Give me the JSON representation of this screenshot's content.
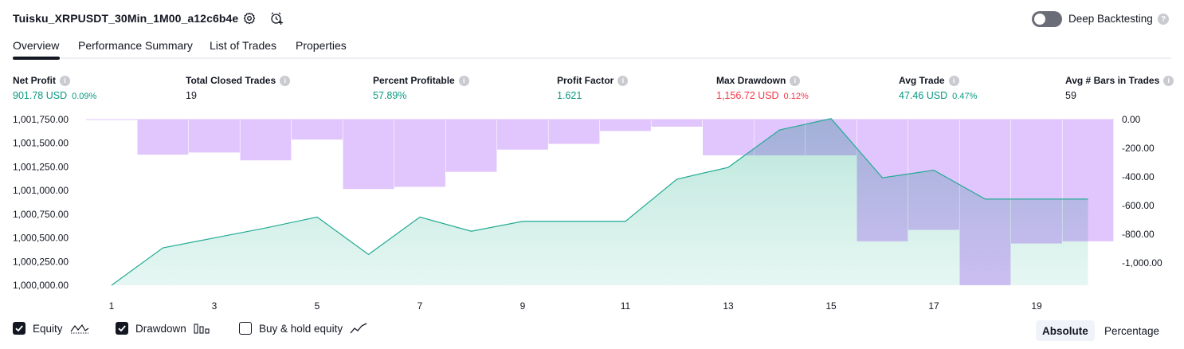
{
  "header": {
    "title": "Tuisku_XRPUSDT_30Min_1M00_a12c6b4e",
    "deep_backtesting_label": "Deep Backtesting",
    "deep_backtesting_on": false
  },
  "tabs": [
    {
      "label": "Overview",
      "active": true
    },
    {
      "label": "Performance Summary",
      "active": false
    },
    {
      "label": "List of Trades",
      "active": false
    },
    {
      "label": "Properties",
      "active": false
    }
  ],
  "stats": [
    {
      "label": "Net Profit",
      "value": "901.78 USD",
      "pct": "0.09%",
      "tone": "green"
    },
    {
      "label": "Total Closed Trades",
      "value": "19",
      "pct": "",
      "tone": "black"
    },
    {
      "label": "Percent Profitable",
      "value": "57.89%",
      "pct": "",
      "tone": "green"
    },
    {
      "label": "Profit Factor",
      "value": "1.621",
      "pct": "",
      "tone": "green"
    },
    {
      "label": "Max Drawdown",
      "value": "1,156.72 USD",
      "pct": "0.12%",
      "tone": "red"
    },
    {
      "label": "Avg Trade",
      "value": "47.46 USD",
      "pct": "0.47%",
      "tone": "green"
    },
    {
      "label": "Avg # Bars in Trades",
      "value": "59",
      "pct": "",
      "tone": "black"
    }
  ],
  "chart_data": {
    "type": "line",
    "colors": {
      "equity_line": "#22ab94",
      "equity_fill": "#d6f1ea",
      "drawdown": "#e1c5fd",
      "drawdown_overlap": "#b4b8e8"
    },
    "x": [
      1,
      2,
      3,
      4,
      5,
      6,
      7,
      8,
      9,
      10,
      11,
      12,
      13,
      14,
      15,
      16,
      17,
      18,
      19,
      20
    ],
    "x_tick_labels": [
      "1",
      "3",
      "5",
      "7",
      "9",
      "11",
      "13",
      "15",
      "17",
      "19"
    ],
    "left_axis_ticks": [
      "1,001,750.00",
      "1,001,500.00",
      "1,001,250.00",
      "1,001,000.00",
      "1,000,750.00",
      "1,000,500.00",
      "1,000,250.00",
      "1,000,000.00"
    ],
    "right_axis_ticks": [
      "0.00",
      "-200.00",
      "-400.00",
      "-600.00",
      "-800.00",
      "-1,000.00"
    ],
    "ylim_left": [
      1000000,
      1001750
    ],
    "ylim_right": [
      -1156.72,
      0
    ],
    "series": [
      {
        "name": "Equity",
        "axis": "left",
        "values": [
          1000000,
          1000395,
          1000500,
          1000605,
          1000720,
          1000325,
          1000720,
          1000570,
          1000675,
          1000675,
          1000675,
          1001120,
          1001245,
          1001640,
          1001760,
          1001135,
          1001215,
          1000910,
          1000910,
          1000910
        ]
      },
      {
        "name": "Drawdown",
        "axis": "right",
        "type": "bar",
        "values": [
          0,
          -245,
          -230,
          -285,
          -140,
          -485,
          -470,
          -365,
          -210,
          -170,
          -80,
          -50,
          -250,
          -250,
          -250,
          -850,
          -770,
          -1156.72,
          -865,
          -850
        ]
      }
    ]
  },
  "legend": {
    "equity_label": "Equity",
    "equity_checked": true,
    "drawdown_label": "Drawdown",
    "drawdown_checked": true,
    "buyhold_label": "Buy & hold equity",
    "buyhold_checked": false
  },
  "view_mode": {
    "absolute_label": "Absolute",
    "percentage_label": "Percentage",
    "active": "absolute"
  }
}
